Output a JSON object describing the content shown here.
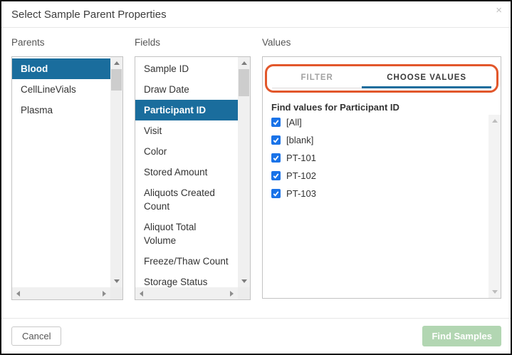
{
  "dialog": {
    "title": "Select Sample Parent Properties",
    "close_icon": "×"
  },
  "parents_panel": {
    "label": "Parents",
    "items": [
      {
        "label": "Blood",
        "selected": true
      },
      {
        "label": "CellLineVials",
        "selected": false
      },
      {
        "label": "Plasma",
        "selected": false
      }
    ]
  },
  "fields_panel": {
    "label": "Fields",
    "items": [
      {
        "label": "Sample ID",
        "selected": false
      },
      {
        "label": "Draw Date",
        "selected": false
      },
      {
        "label": "Participant ID",
        "selected": true
      },
      {
        "label": "Visit",
        "selected": false
      },
      {
        "label": "Color",
        "selected": false
      },
      {
        "label": "Stored Amount",
        "selected": false
      },
      {
        "label": "Aliquots Created Count",
        "selected": false
      },
      {
        "label": "Aliquot Total Volume",
        "selected": false
      },
      {
        "label": "Freeze/Thaw Count",
        "selected": false
      },
      {
        "label": "Storage Status",
        "selected": false
      }
    ]
  },
  "values_panel": {
    "label": "Values",
    "tabs": [
      {
        "label": "FILTER",
        "active": false
      },
      {
        "label": "CHOOSE VALUES",
        "active": true
      }
    ],
    "find_values_label": "Find values for Participant ID",
    "options": [
      {
        "label": "[All]",
        "checked": true
      },
      {
        "label": "[blank]",
        "checked": true
      },
      {
        "label": "PT-101",
        "checked": true
      },
      {
        "label": "PT-102",
        "checked": true
      },
      {
        "label": "PT-103",
        "checked": true
      }
    ]
  },
  "footer": {
    "cancel_label": "Cancel",
    "find_samples_label": "Find Samples",
    "find_samples_enabled": false
  },
  "colors": {
    "selection_blue": "#1a6d9d",
    "tab_active_underline": "#1a6d9d",
    "checkbox_blue": "#1a73e8",
    "highlight_orange": "#e2572b",
    "disabled_button_green": "#b2d6b2"
  }
}
